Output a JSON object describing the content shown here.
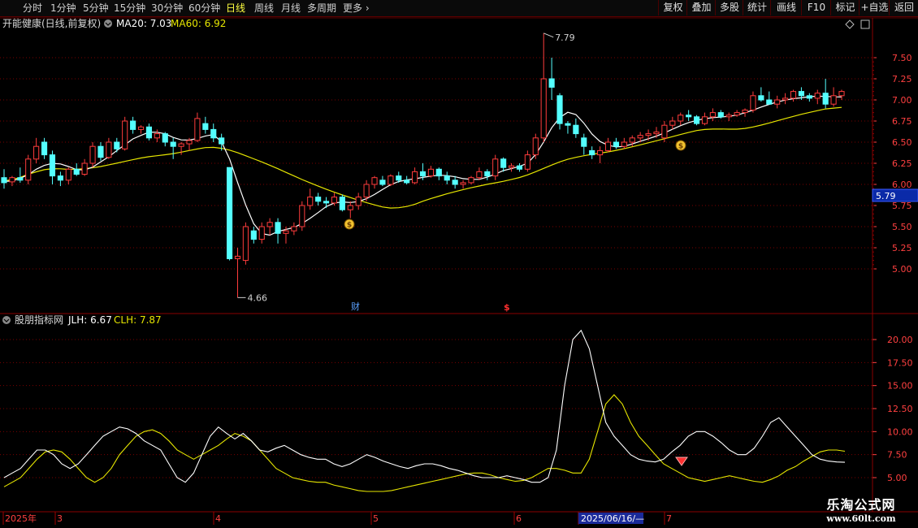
{
  "toolbar": {
    "periods": [
      "分时",
      "1分钟",
      "5分钟",
      "15分钟",
      "30分钟",
      "60分钟",
      "日线",
      "周线",
      "月线",
      "多周期",
      "更多"
    ],
    "active_period": "日线",
    "right_buttons": [
      "复权",
      "叠加",
      "多股",
      "统计",
      "画线",
      "F10",
      "标记",
      "+自选",
      "返回"
    ]
  },
  "main_panel": {
    "stock_title": "开能健康(日线,前复权)",
    "ma20_label": "MA20: 7.03",
    "ma60_label": "MA60: 6.92",
    "price_ticks": [
      "7.50",
      "7.25",
      "7.00",
      "6.75",
      "6.50",
      "6.25",
      "6.00",
      "5.75",
      "5.50",
      "5.25",
      "5.00"
    ],
    "current_price": "5.79",
    "high_label": "7.79",
    "low_label": "4.66",
    "event_mark_1": "财",
    "event_mark_2": "$"
  },
  "sub_panel": {
    "title": "股朋指标网",
    "jlh_label": "JLH: 6.67",
    "clh_label": "CLH: 7.87",
    "ticks": [
      "20.00",
      "17.50",
      "15.00",
      "12.50",
      "10.00",
      "7.50",
      "5.00"
    ]
  },
  "time_axis": {
    "labels": [
      "2025年",
      "3",
      "4",
      "5",
      "6",
      "2025/06/16/—",
      "7"
    ]
  },
  "watermark": {
    "title": "乐淘公式网",
    "url": "www.60lt.com"
  },
  "colors": {
    "up": "#ff3c3c",
    "down": "#54ffff",
    "ma_white": "#ffffff",
    "ma_yellow": "#e6e600",
    "grid": "#7a0000",
    "axis_text": "#ff4040"
  },
  "chart_data": {
    "type": "candlestick",
    "price_axis": {
      "ylim": [
        4.66,
        7.79
      ]
    },
    "sub_axis": {
      "ylim": [
        4.0,
        21.0
      ]
    },
    "candles": [
      [
        6.08,
        6.18,
        5.95,
        6.02
      ],
      [
        6.03,
        6.1,
        5.98,
        6.08
      ],
      [
        6.08,
        6.2,
        6.02,
        6.05
      ],
      [
        6.05,
        6.35,
        6.0,
        6.3
      ],
      [
        6.3,
        6.55,
        6.25,
        6.45
      ],
      [
        6.5,
        6.55,
        6.3,
        6.35
      ],
      [
        6.35,
        6.4,
        6.0,
        6.1
      ],
      [
        6.1,
        6.15,
        5.98,
        6.05
      ],
      [
        6.05,
        6.2,
        6.0,
        6.18
      ],
      [
        6.18,
        6.25,
        6.1,
        6.12
      ],
      [
        6.12,
        6.3,
        6.1,
        6.25
      ],
      [
        6.25,
        6.5,
        6.2,
        6.45
      ],
      [
        6.45,
        6.5,
        6.28,
        6.32
      ],
      [
        6.32,
        6.55,
        6.3,
        6.5
      ],
      [
        6.5,
        6.55,
        6.38,
        6.42
      ],
      [
        6.42,
        6.8,
        6.4,
        6.75
      ],
      [
        6.75,
        6.8,
        6.6,
        6.65
      ],
      [
        6.65,
        6.7,
        6.6,
        6.68
      ],
      [
        6.68,
        6.72,
        6.52,
        6.55
      ],
      [
        6.55,
        6.65,
        6.5,
        6.6
      ],
      [
        6.6,
        6.62,
        6.45,
        6.5
      ],
      [
        6.5,
        6.55,
        6.3,
        6.45
      ],
      [
        6.45,
        6.5,
        6.35,
        6.48
      ],
      [
        6.48,
        6.55,
        6.4,
        6.52
      ],
      [
        6.52,
        6.85,
        6.5,
        6.78
      ],
      [
        6.72,
        6.8,
        6.6,
        6.65
      ],
      [
        6.65,
        6.72,
        6.5,
        6.55
      ],
      [
        6.55,
        6.6,
        6.4,
        6.48
      ],
      [
        6.2,
        6.2,
        5.1,
        5.12
      ],
      [
        5.12,
        5.25,
        4.66,
        5.15
      ],
      [
        5.1,
        5.55,
        5.05,
        5.5
      ],
      [
        5.45,
        5.5,
        5.3,
        5.35
      ],
      [
        5.35,
        5.55,
        5.3,
        5.5
      ],
      [
        5.5,
        5.6,
        5.4,
        5.55
      ],
      [
        5.55,
        5.6,
        5.3,
        5.42
      ],
      [
        5.42,
        5.5,
        5.3,
        5.45
      ],
      [
        5.45,
        5.55,
        5.4,
        5.5
      ],
      [
        5.5,
        5.8,
        5.45,
        5.75
      ],
      [
        5.75,
        5.95,
        5.7,
        5.85
      ],
      [
        5.85,
        5.9,
        5.75,
        5.8
      ],
      [
        5.8,
        5.85,
        5.72,
        5.78
      ],
      [
        5.78,
        5.9,
        5.75,
        5.85
      ],
      [
        5.85,
        5.88,
        5.68,
        5.7
      ],
      [
        5.7,
        5.8,
        5.6,
        5.75
      ],
      [
        5.75,
        5.9,
        5.7,
        5.85
      ],
      [
        5.85,
        6.05,
        5.8,
        6.0
      ],
      [
        6.0,
        6.1,
        5.95,
        6.08
      ],
      [
        6.05,
        6.1,
        5.98,
        6.0
      ],
      [
        6.0,
        6.12,
        5.98,
        6.1
      ],
      [
        6.1,
        6.15,
        6.02,
        6.05
      ],
      [
        6.05,
        6.1,
        6.0,
        6.02
      ],
      [
        6.02,
        6.2,
        6.0,
        6.15
      ],
      [
        6.15,
        6.25,
        6.05,
        6.1
      ],
      [
        6.1,
        6.22,
        6.08,
        6.18
      ],
      [
        6.18,
        6.2,
        6.05,
        6.1
      ],
      [
        6.1,
        6.15,
        6.0,
        6.05
      ],
      [
        6.05,
        6.1,
        5.95,
        6.0
      ],
      [
        6.0,
        6.05,
        5.95,
        6.02
      ],
      [
        6.02,
        6.1,
        6.0,
        6.08
      ],
      [
        6.08,
        6.2,
        6.05,
        6.15
      ],
      [
        6.15,
        6.18,
        6.05,
        6.1
      ],
      [
        6.1,
        6.35,
        6.05,
        6.3
      ],
      [
        6.3,
        6.32,
        6.15,
        6.2
      ],
      [
        6.2,
        6.25,
        6.15,
        6.22
      ],
      [
        6.22,
        6.25,
        6.15,
        6.18
      ],
      [
        6.18,
        6.4,
        6.15,
        6.35
      ],
      [
        6.35,
        6.6,
        6.3,
        6.55
      ],
      [
        6.55,
        7.79,
        6.5,
        7.25
      ],
      [
        7.25,
        7.5,
        7.0,
        7.15
      ],
      [
        7.05,
        7.08,
        6.65,
        6.72
      ],
      [
        6.72,
        6.75,
        6.6,
        6.7
      ],
      [
        6.7,
        6.78,
        6.55,
        6.6
      ],
      [
        6.55,
        6.6,
        6.35,
        6.45
      ],
      [
        6.4,
        6.45,
        6.3,
        6.35
      ],
      [
        6.35,
        6.45,
        6.25,
        6.4
      ],
      [
        6.4,
        6.55,
        6.38,
        6.5
      ],
      [
        6.5,
        6.55,
        6.42,
        6.45
      ],
      [
        6.45,
        6.55,
        6.42,
        6.5
      ],
      [
        6.5,
        6.58,
        6.45,
        6.55
      ],
      [
        6.55,
        6.62,
        6.5,
        6.58
      ],
      [
        6.58,
        6.65,
        6.52,
        6.6
      ],
      [
        6.6,
        6.68,
        6.55,
        6.62
      ],
      [
        6.55,
        6.75,
        6.5,
        6.7
      ],
      [
        6.7,
        6.8,
        6.65,
        6.75
      ],
      [
        6.75,
        6.85,
        6.7,
        6.82
      ],
      [
        6.82,
        6.88,
        6.75,
        6.8
      ],
      [
        6.8,
        6.82,
        6.7,
        6.72
      ],
      [
        6.72,
        6.85,
        6.7,
        6.8
      ],
      [
        6.8,
        6.9,
        6.75,
        6.85
      ],
      [
        6.85,
        6.88,
        6.78,
        6.8
      ],
      [
        6.8,
        6.85,
        6.75,
        6.82
      ],
      [
        6.82,
        6.88,
        6.8,
        6.85
      ],
      [
        6.85,
        6.9,
        6.8,
        6.88
      ],
      [
        6.88,
        7.1,
        6.85,
        7.05
      ],
      [
        7.05,
        7.15,
        6.98,
        7.0
      ],
      [
        7.0,
        7.1,
        6.95,
        6.95
      ],
      [
        6.95,
        7.05,
        6.9,
        7.0
      ],
      [
        7.0,
        7.08,
        6.95,
        7.02
      ],
      [
        7.02,
        7.12,
        6.98,
        7.1
      ],
      [
        7.1,
        7.15,
        7.0,
        7.05
      ],
      [
        7.05,
        7.08,
        6.98,
        7.02
      ],
      [
        7.02,
        7.12,
        6.95,
        7.08
      ],
      [
        7.08,
        7.25,
        6.9,
        6.95
      ],
      [
        6.95,
        7.15,
        6.92,
        7.05
      ],
      [
        7.05,
        7.12,
        7.0,
        7.1
      ]
    ],
    "jlh": [
      5.0,
      5.5,
      6.0,
      7.0,
      8.0,
      8.0,
      7.5,
      6.5,
      6.0,
      6.5,
      7.5,
      8.5,
      9.5,
      10.0,
      10.5,
      10.3,
      9.8,
      9.0,
      8.5,
      8.0,
      6.5,
      5.0,
      4.5,
      5.5,
      7.5,
      9.5,
      10.5,
      9.8,
      9.2,
      9.8,
      9.0,
      8.0,
      7.8,
      8.2,
      8.5,
      8.0,
      7.5,
      7.2,
      7.0,
      7.0,
      6.5,
      6.2,
      6.5,
      7.0,
      7.5,
      7.2,
      6.8,
      6.5,
      6.2,
      6.0,
      6.3,
      6.5,
      6.5,
      6.3,
      6.0,
      5.8,
      5.5,
      5.2,
      5.0,
      5.0,
      5.0,
      5.2,
      5.0,
      4.8,
      4.5,
      4.5,
      5.0,
      8.0,
      15.0,
      20.0,
      21.0,
      19.0,
      15.0,
      11.0,
      9.5,
      8.5,
      7.5,
      7.0,
      6.8,
      6.7,
      7.0,
      7.8,
      8.5,
      9.5,
      10.0,
      10.0,
      9.5,
      8.8,
      8.0,
      7.5,
      7.5,
      8.2,
      9.5,
      11.0,
      11.5,
      10.5,
      9.5,
      8.5,
      7.5,
      7.0,
      6.8,
      6.7,
      6.67
    ],
    "clh": [
      4.0,
      4.5,
      5.0,
      6.0,
      7.0,
      7.8,
      8.0,
      7.8,
      7.0,
      6.0,
      5.0,
      4.5,
      5.0,
      6.0,
      7.5,
      8.5,
      9.5,
      10.0,
      10.2,
      9.8,
      9.0,
      8.0,
      7.5,
      7.0,
      7.5,
      8.0,
      8.5,
      9.2,
      9.8,
      9.5,
      9.0,
      8.0,
      7.0,
      6.0,
      5.5,
      5.0,
      4.8,
      4.6,
      4.5,
      4.5,
      4.2,
      4.0,
      3.8,
      3.6,
      3.5,
      3.5,
      3.5,
      3.6,
      3.8,
      4.0,
      4.2,
      4.4,
      4.6,
      4.8,
      5.0,
      5.2,
      5.4,
      5.5,
      5.5,
      5.3,
      5.0,
      4.8,
      4.6,
      4.7,
      5.0,
      5.5,
      6.0,
      6.0,
      5.8,
      5.5,
      5.5,
      7.0,
      10.0,
      13.0,
      14.0,
      13.0,
      11.0,
      9.5,
      8.5,
      7.5,
      6.5,
      6.0,
      5.5,
      5.0,
      4.8,
      4.6,
      4.8,
      5.0,
      5.2,
      5.0,
      4.8,
      4.6,
      4.5,
      4.8,
      5.2,
      5.8,
      6.2,
      6.8,
      7.3,
      7.8,
      8.0,
      8.0,
      7.87
    ]
  }
}
